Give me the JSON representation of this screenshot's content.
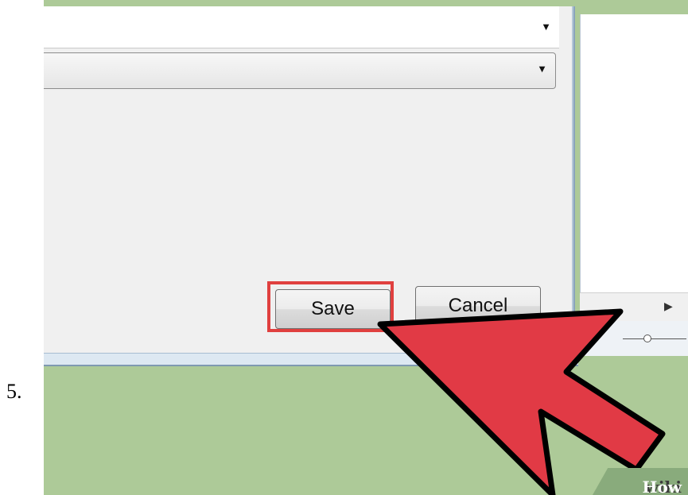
{
  "step": {
    "number": "5."
  },
  "dialog": {
    "save_label": "Save",
    "cancel_label": "Cancel"
  },
  "brand": {
    "wiki": "wiki",
    "how": "How"
  },
  "colors": {
    "background": "#adca98",
    "highlight": "#e0403f",
    "pointer_arrow": "#e13a45"
  },
  "icons": [
    "dropdown-arrow-icon",
    "dropdown-arrow-icon",
    "scroll-right-icon",
    "zoom-slider-icon",
    "pointer-arrow"
  ]
}
